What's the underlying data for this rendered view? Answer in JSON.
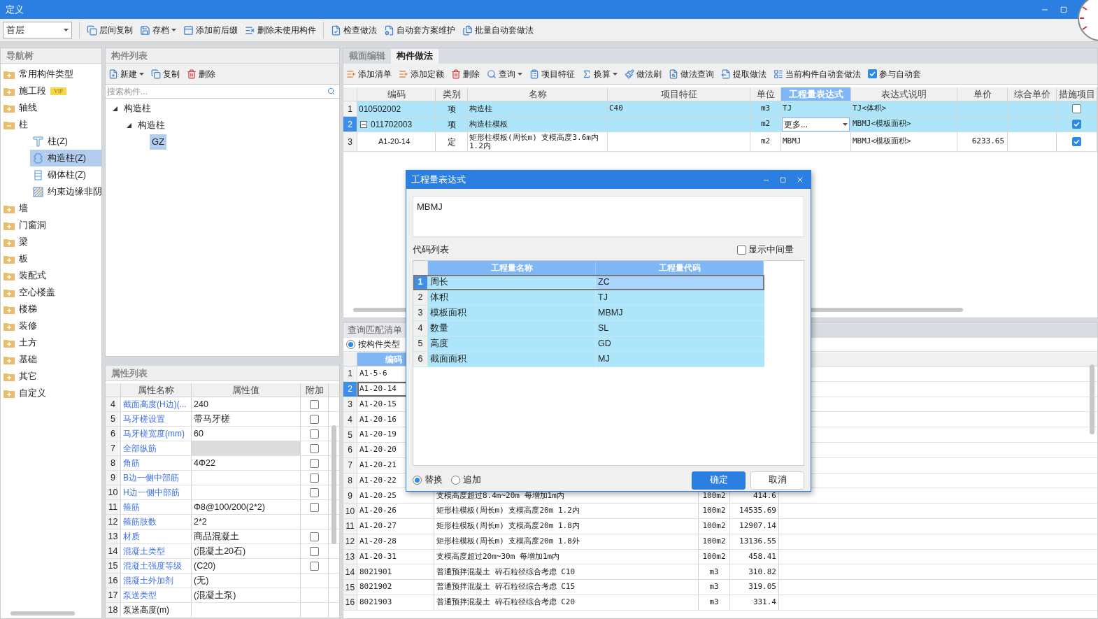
{
  "window": {
    "title": "定义"
  },
  "floor_select": {
    "value": "首层"
  },
  "toolbar": [
    [
      {
        "label": "层间复制",
        "dropdown": false
      },
      {
        "label": "存档",
        "dropdown": true
      },
      {
        "label": "添加前后缀",
        "dropdown": false
      },
      {
        "label": "删除未使用构件",
        "dropdown": false
      }
    ],
    [
      {
        "label": "检查做法",
        "dropdown": false
      },
      {
        "label": "自动套方案维护",
        "dropdown": false
      },
      {
        "label": "批量自动套做法",
        "dropdown": false
      }
    ]
  ],
  "nav_tree": {
    "title": "导航树",
    "items": [
      {
        "label": "常用构件类型",
        "expanded": false,
        "selected": false
      },
      {
        "label": "施工段",
        "badge": "VIP",
        "expanded": false,
        "selected": false
      },
      {
        "label": "轴线",
        "expanded": false,
        "selected": false
      },
      {
        "label": "柱",
        "expanded": true,
        "selected": false,
        "children": [
          {
            "label": "柱(Z)",
            "selected": false
          },
          {
            "label": "构造柱(Z)",
            "selected": true
          },
          {
            "label": "砌体柱(Z)",
            "selected": false
          },
          {
            "label": "约束边缘非阴",
            "selected": false
          }
        ]
      },
      {
        "label": "墙",
        "expanded": false,
        "selected": false
      },
      {
        "label": "门窗洞",
        "expanded": false,
        "selected": false
      },
      {
        "label": "梁",
        "expanded": false,
        "selected": false
      },
      {
        "label": "板",
        "expanded": false,
        "selected": false
      },
      {
        "label": "装配式",
        "expanded": false,
        "selected": false
      },
      {
        "label": "空心楼盖",
        "expanded": false,
        "selected": false
      },
      {
        "label": "楼梯",
        "expanded": false,
        "selected": false
      },
      {
        "label": "装修",
        "expanded": false,
        "selected": false
      },
      {
        "label": "土方",
        "expanded": false,
        "selected": false
      },
      {
        "label": "基础",
        "expanded": false,
        "selected": false
      },
      {
        "label": "其它",
        "expanded": false,
        "selected": false
      },
      {
        "label": "自定义",
        "expanded": false,
        "selected": false
      }
    ]
  },
  "component_list": {
    "title": "构件列表",
    "toolbar": [
      {
        "label": "新建",
        "dropdown": true
      },
      {
        "label": "复制",
        "dropdown": false
      },
      {
        "label": "删除",
        "dropdown": false
      }
    ],
    "search": {
      "placeholder": "搜索构件..."
    },
    "tree": [
      {
        "label": "构造柱",
        "expanded": true,
        "selected": false,
        "children": [
          {
            "label": "构造柱",
            "expanded": true,
            "selected": false,
            "children": [
              {
                "label": "GZ",
                "selected": true
              }
            ]
          }
        ]
      }
    ]
  },
  "properties": {
    "title": "属性列表",
    "columns": [
      "属性名称",
      "属性值",
      "附加"
    ],
    "rows": [
      {
        "num": "4",
        "name": "截面高度(H边)(...",
        "value": "240",
        "public": true,
        "disabled": false,
        "checked": false
      },
      {
        "num": "5",
        "name": "马牙槎设置",
        "value": "带马牙槎",
        "public": true,
        "disabled": false,
        "checked": false
      },
      {
        "num": "6",
        "name": "马牙槎宽度(mm)",
        "value": "60",
        "public": true,
        "disabled": false,
        "checked": false
      },
      {
        "num": "7",
        "name": "全部纵筋",
        "public": true,
        "disabled": true,
        "checked": false
      },
      {
        "num": "8",
        "name": "角筋",
        "value": "4Φ22",
        "public": true,
        "disabled": false,
        "checked": false
      },
      {
        "num": "9",
        "name": "B边一侧中部筋",
        "public": true,
        "disabled": false,
        "checked": false
      },
      {
        "num": "10",
        "name": "H边一侧中部筋",
        "public": true,
        "disabled": false,
        "checked": false
      },
      {
        "num": "11",
        "name": "箍筋",
        "value": "Φ8@100/200(2*2)",
        "public": true,
        "disabled": false,
        "checked": false
      },
      {
        "num": "12",
        "name": "箍筋肢数",
        "value": "2*2",
        "public": true,
        "disabled": false
      },
      {
        "num": "13",
        "name": "材质",
        "value": "商品混凝土",
        "public": true,
        "disabled": false,
        "checked": false
      },
      {
        "num": "14",
        "name": "混凝土类型",
        "value": "(混凝土20石)",
        "public": true,
        "disabled": false,
        "checked": false
      },
      {
        "num": "15",
        "name": "混凝土强度等级",
        "value": "(C20)",
        "public": true,
        "disabled": false,
        "checked": false
      },
      {
        "num": "16",
        "name": "混凝土外加剂",
        "value": "(无)",
        "public": true,
        "disabled": false
      },
      {
        "num": "17",
        "name": "泵送类型",
        "value": "(混凝土泵)",
        "public": true,
        "disabled": false
      },
      {
        "num": "18",
        "name": "泵送高度(m)",
        "public": false,
        "disabled": false
      }
    ]
  },
  "method_panel": {
    "tabs": [
      {
        "label": "截面编辑",
        "selected": false
      },
      {
        "label": "构件做法",
        "selected": true
      }
    ],
    "toolbar": [
      {
        "label": "添加清单",
        "kind": "button",
        "dropdown": false
      },
      {
        "label": "添加定额",
        "kind": "button",
        "dropdown": false
      },
      {
        "label": "删除",
        "kind": "button",
        "dropdown": false
      },
      {
        "label": "查询",
        "kind": "button",
        "dropdown": true
      },
      {
        "label": "项目特征",
        "kind": "button",
        "dropdown": false
      },
      {
        "label": "换算",
        "kind": "button",
        "dropdown": true
      },
      {
        "label": "做法刷",
        "kind": "button",
        "dropdown": false
      },
      {
        "label": "做法查询",
        "kind": "button",
        "dropdown": false
      },
      {
        "label": "提取做法",
        "kind": "button",
        "dropdown": false
      },
      {
        "label": "当前构件自动套做法",
        "kind": "button",
        "dropdown": false
      },
      {
        "label": "参与自动套",
        "kind": "checkbox",
        "checked": true
      }
    ],
    "table": {
      "columns": [
        {
          "label": "编码",
          "highlighted": false
        },
        {
          "label": "类别",
          "highlighted": false
        },
        {
          "label": "名称",
          "highlighted": false
        },
        {
          "label": "项目特征",
          "highlighted": false
        },
        {
          "label": "单位",
          "highlighted": false
        },
        {
          "label": "工程量表达式",
          "highlighted": true
        },
        {
          "label": "表达式说明",
          "highlighted": false
        },
        {
          "label": "单价",
          "highlighted": false
        },
        {
          "label": "综合单价",
          "highlighted": false
        },
        {
          "label": "措施项目",
          "highlighted": false
        }
      ],
      "rows": [
        {
          "num": "1",
          "kind": "list",
          "selected": false,
          "code": "010502002",
          "type": "项",
          "name": "构造柱",
          "feature": "C40",
          "unit": "m3",
          "expr": "TJ",
          "editing": false,
          "expr_note": "TJ<体积>",
          "measure": false
        },
        {
          "num": "2",
          "kind": "list",
          "selected": true,
          "expanded": true,
          "code": "011702003",
          "type": "项",
          "name": "构造柱模板",
          "unit": "m2",
          "expr": "更多...",
          "editing": true,
          "expr_note": "MBMJ<模板面积>",
          "measure": true
        },
        {
          "num": "3",
          "kind": "quota",
          "selected": false,
          "code": "A1-20-14",
          "type": "定",
          "name": "矩形柱模板(周长m) 支模高度3.6m内 1.2内",
          "unit": "m2",
          "expr": "MBMJ",
          "editing": false,
          "expr_note": "MBMJ<模板面积>",
          "price": "6233.65",
          "measure": true
        }
      ]
    }
  },
  "match_panel": {
    "tab": {
      "label": "查询匹配清单"
    },
    "filter": {
      "label": "按构件类型",
      "selected": true
    },
    "table": {
      "columns": [
        "编码"
      ],
      "rows": [
        {
          "num": "1",
          "code": "A1-5-6",
          "selected": false
        },
        {
          "num": "2",
          "code": "A1-20-14",
          "selected": true
        },
        {
          "num": "3",
          "code": "A1-20-15",
          "selected": false
        },
        {
          "num": "4",
          "code": "A1-20-16",
          "selected": false
        },
        {
          "num": "5",
          "code": "A1-20-19",
          "selected": false
        },
        {
          "num": "6",
          "code": "A1-20-20",
          "selected": false
        },
        {
          "num": "7",
          "code": "A1-20-21",
          "selected": false
        },
        {
          "num": "8",
          "code": "A1-20-22",
          "selected": false
        },
        {
          "num": "9",
          "code": "A1-20-25",
          "name": "支模高度超过8.4m~20m 每增加1m内",
          "unit": "100m2",
          "price": "414.6",
          "selected": false
        },
        {
          "num": "10",
          "code": "A1-20-26",
          "name": "矩形柱模板(周长m) 支模高度20m 1.2内",
          "unit": "100m2",
          "price": "14535.69",
          "selected": false
        },
        {
          "num": "11",
          "code": "A1-20-27",
          "name": "矩形柱模板(周长m) 支模高度20m 1.8内",
          "unit": "100m2",
          "price": "12907.14",
          "selected": false
        },
        {
          "num": "12",
          "code": "A1-20-28",
          "name": "矩形柱模板(周长m) 支模高度20m 1.8外",
          "unit": "100m2",
          "price": "13136.55",
          "selected": false
        },
        {
          "num": "13",
          "code": "A1-20-31",
          "name": "支模高度超过20m~30m 每增加1m内",
          "unit": "100m2",
          "price": "458.41",
          "selected": false
        },
        {
          "num": "14",
          "code": "8021901",
          "name": "普通预拌混凝土 碎石粒径综合考虑 C10",
          "unit": "m3",
          "price": "310.82",
          "selected": false
        },
        {
          "num": "15",
          "code": "8021902",
          "name": "普通预拌混凝土 碎石粒径综合考虑 C15",
          "unit": "m3",
          "price": "319.05",
          "selected": false
        },
        {
          "num": "16",
          "code": "8021903",
          "name": "普通预拌混凝土 碎石粒径综合考虑 C20",
          "unit": "m3",
          "price": "331.4",
          "selected": false
        }
      ]
    }
  },
  "dialog": {
    "title": "工程量表达式",
    "expression": "MBMJ",
    "code_list_label": "代码列表",
    "show_intermediate": {
      "label": "显示中间量",
      "checked": false
    },
    "columns": [
      "工程量名称",
      "工程量代码"
    ],
    "rows": [
      {
        "num": "1",
        "name": "周长",
        "code": "ZC",
        "selected": true
      },
      {
        "num": "2",
        "name": "体积",
        "code": "TJ",
        "selected": false
      },
      {
        "num": "3",
        "name": "模板面积",
        "code": "MBMJ",
        "selected": false
      },
      {
        "num": "4",
        "name": "数量",
        "code": "SL",
        "selected": false
      },
      {
        "num": "5",
        "name": "高度",
        "code": "GD",
        "selected": false
      },
      {
        "num": "6",
        "name": "截面面积",
        "code": "MJ",
        "selected": false
      }
    ],
    "mode": [
      {
        "label": "替换",
        "selected": true
      },
      {
        "label": "追加",
        "selected": false
      }
    ],
    "buttons": [
      {
        "label": "确定",
        "kind": "primary"
      },
      {
        "label": "取消",
        "kind": "secondary"
      }
    ]
  }
}
